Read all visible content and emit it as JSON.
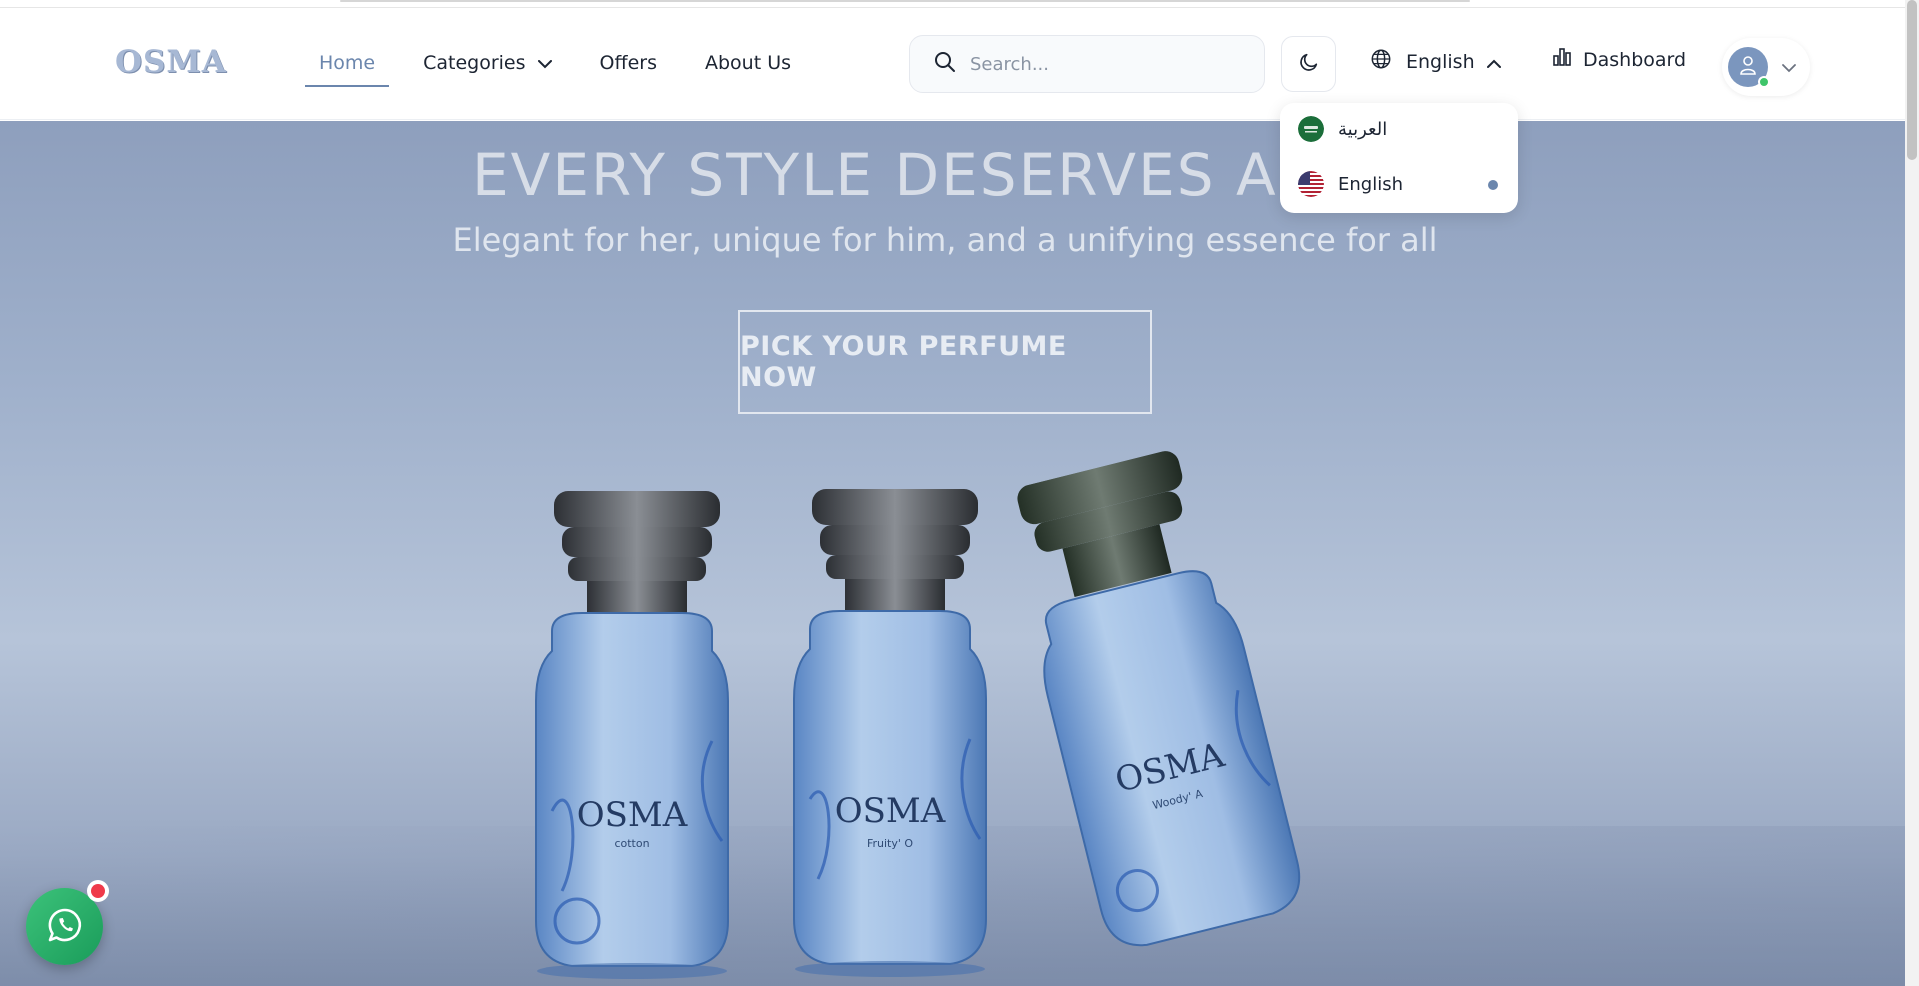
{
  "header": {
    "logo": "OSMA",
    "nav": [
      {
        "label": "Home",
        "active": true
      },
      {
        "label": "Categories",
        "has_dropdown": true
      },
      {
        "label": "Offers"
      },
      {
        "label": "About Us"
      }
    ],
    "search_placeholder": "Search...",
    "theme_icon": "moon-icon",
    "language_label": "English",
    "dashboard_label": "Dashboard"
  },
  "language_menu": {
    "open": true,
    "options": [
      {
        "label": "العربية",
        "flag": "saudi-flag-icon",
        "selected": false
      },
      {
        "label": "English",
        "flag": "us-flag-icon",
        "selected": true
      }
    ]
  },
  "hero": {
    "title": "EVERY STYLE DESERVES A SC",
    "subtitle": "Elegant for her, unique for him, and a unifying essence for all",
    "cta_label": "PICK YOUR PERFUME NOW",
    "bottles": [
      {
        "brand": "OSMA",
        "variant": "Cotton"
      },
      {
        "brand": "OSMA",
        "variant": "Fruity' O"
      },
      {
        "brand": "OSMA",
        "variant": "Woody' A"
      }
    ]
  },
  "colors": {
    "accent": "#6b86ad",
    "whatsapp": "#25b36b",
    "notification": "#ef3a4a"
  }
}
